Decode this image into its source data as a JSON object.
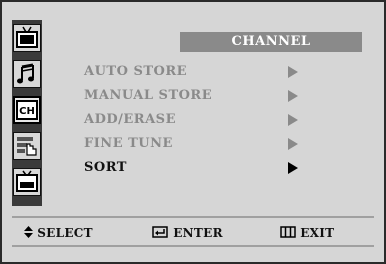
{
  "menu": {
    "title": "CHANNEL",
    "items": [
      {
        "label": "AUTO STORE",
        "selected": false
      },
      {
        "label": "MANUAL STORE",
        "selected": false
      },
      {
        "label": "ADD/ERASE",
        "selected": false
      },
      {
        "label": "FINE TUNE",
        "selected": false
      },
      {
        "label": "SORT",
        "selected": true
      }
    ]
  },
  "sidebar": {
    "icons": [
      {
        "name": "picture-icon",
        "active": false
      },
      {
        "name": "sound-icon",
        "active": false
      },
      {
        "name": "channel-icon",
        "label": "CH",
        "active": true
      },
      {
        "name": "setup-icon",
        "active": false
      },
      {
        "name": "input-icon",
        "active": false
      }
    ]
  },
  "help": {
    "select": "SELECT",
    "enter": "ENTER",
    "exit": "EXIT"
  },
  "colors": {
    "background": "#d6d6d6",
    "title_bar": "#8a8a8a",
    "inactive_text": "#8a8a8a",
    "active_text": "#111111",
    "rail": "#3a3a3a"
  }
}
